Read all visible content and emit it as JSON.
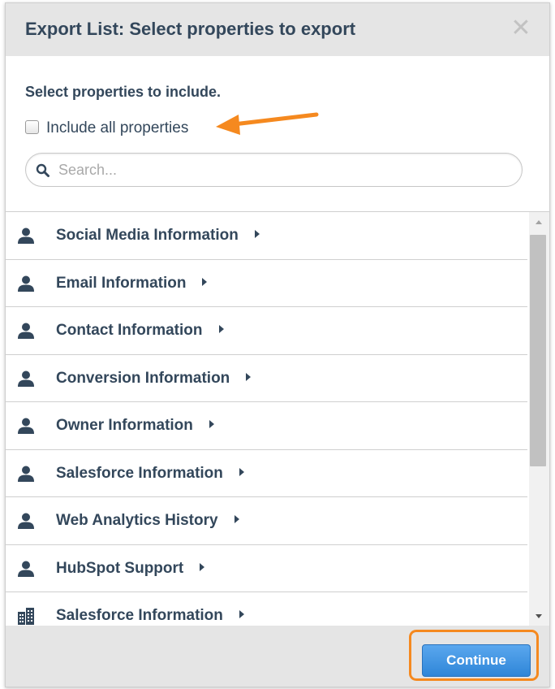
{
  "modal": {
    "title": "Export List: Select properties to export",
    "close_icon": "close-icon"
  },
  "section": {
    "label": "Select properties to include."
  },
  "include_all": {
    "label": "Include all properties",
    "checked": false
  },
  "search": {
    "placeholder": "Search...",
    "value": ""
  },
  "property_groups": [
    {
      "label": "Social Media Information",
      "icon": "contact-icon"
    },
    {
      "label": "Email Information",
      "icon": "contact-icon"
    },
    {
      "label": "Contact Information",
      "icon": "contact-icon"
    },
    {
      "label": "Conversion Information",
      "icon": "contact-icon"
    },
    {
      "label": "Owner Information",
      "icon": "contact-icon"
    },
    {
      "label": "Salesforce Information",
      "icon": "contact-icon"
    },
    {
      "label": "Web Analytics History",
      "icon": "contact-icon"
    },
    {
      "label": "HubSpot Support",
      "icon": "contact-icon"
    },
    {
      "label": "Salesforce Information",
      "icon": "company-icon"
    }
  ],
  "footer": {
    "continue_label": "Continue"
  },
  "colors": {
    "text": "#33475b",
    "header_bg": "#e5e5e5",
    "accent_orange": "#f5891f",
    "button_blue": "#3d8fdf"
  }
}
